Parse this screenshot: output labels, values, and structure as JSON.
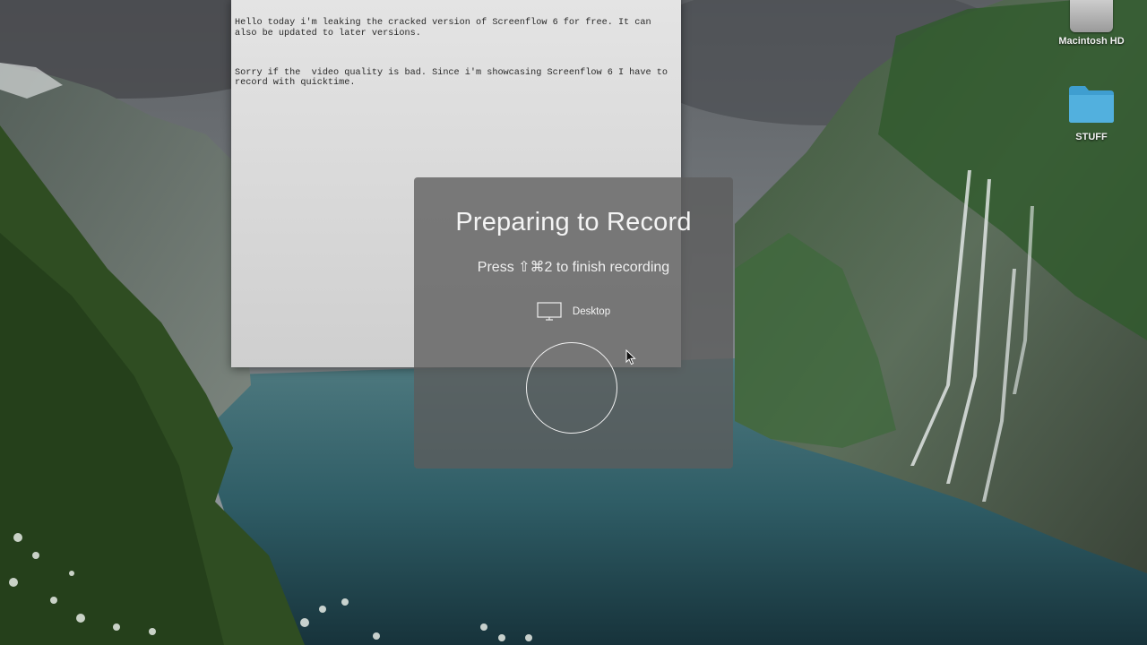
{
  "editor": {
    "line1": "Hello today i'm leaking the cracked version of Screenflow 6 for free. It can also be updated to later versions.",
    "line2": "Sorry if the  video quality is bad. Since i'm showcasing Screenflow 6 I have to record with quicktime."
  },
  "desktop": {
    "icons": [
      {
        "label": "Macintosh HD",
        "icon": "hard-drive-icon"
      },
      {
        "label": "STUFF",
        "icon": "folder-icon",
        "color": "#3f9ed0"
      }
    ]
  },
  "recorder": {
    "title": "Preparing to Record",
    "hint": "Press ⇧⌘2 to finish recording",
    "source": {
      "label": "Desktop",
      "icon": "monitor-icon"
    },
    "record_button": "record-ring"
  }
}
